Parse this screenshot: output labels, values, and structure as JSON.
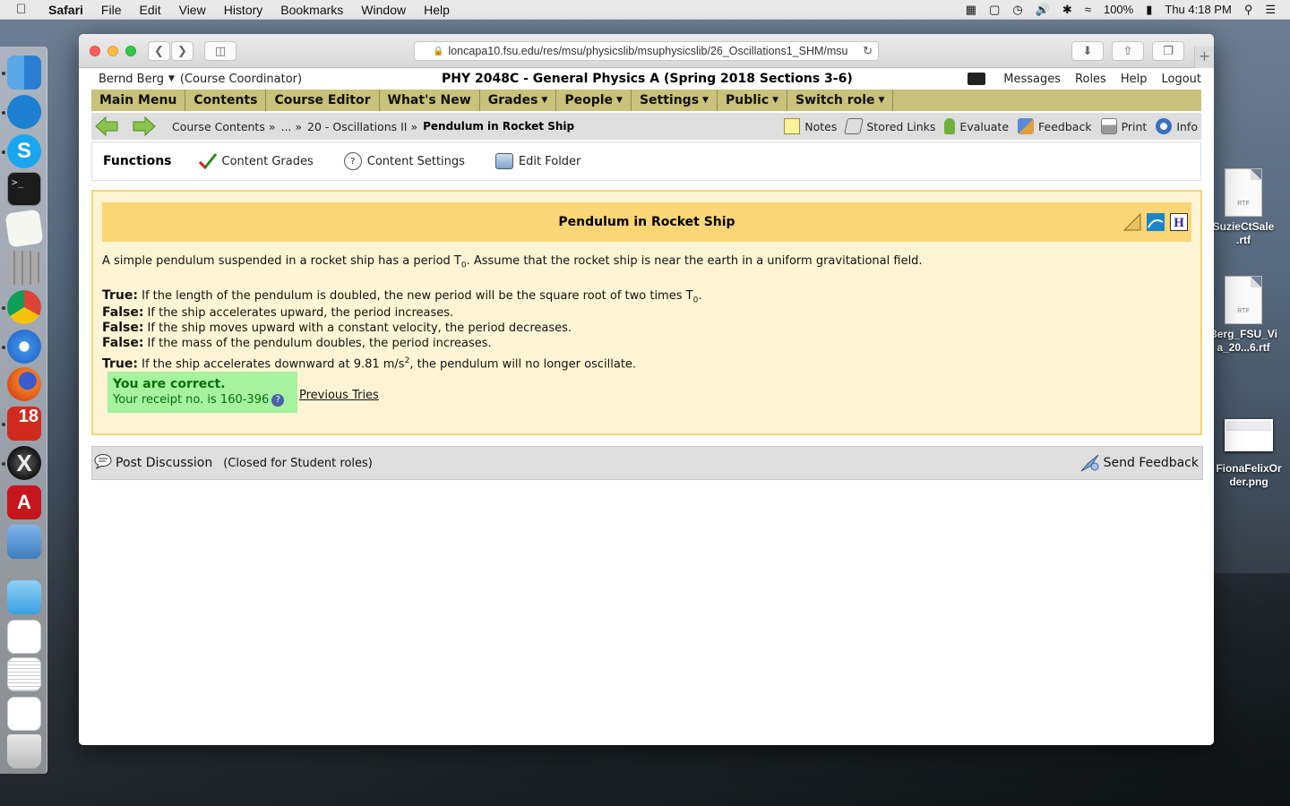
{
  "menubar": {
    "app": "Safari",
    "items": [
      "File",
      "Edit",
      "View",
      "History",
      "Bookmarks",
      "Window",
      "Help"
    ],
    "battery": "100%",
    "clock": "Thu 4:18 PM"
  },
  "desktop_files": [
    {
      "name": "SuzieCtSale\n.rtf",
      "badge": "RTF"
    },
    {
      "name": "Berg_FSU_Vi\na_20...6.rtf",
      "badge": "RTF"
    },
    {
      "name": "FionaFelixOr\nder.png"
    }
  ],
  "browser": {
    "url": "loncapa10.fsu.edu/res/msu/physicslib/msuphysicslib/26_Oscillations1_SHM/msu"
  },
  "userbar": {
    "user": "Bernd Berg",
    "role": "(Course Coordinator)",
    "course": "PHY 2048C - General Physics A (Spring 2018 Sections 3-6)",
    "links": [
      "Messages",
      "Roles",
      "Help",
      "Logout"
    ]
  },
  "mainmenu": [
    {
      "label": "Main Menu",
      "dropdown": false
    },
    {
      "label": "Contents",
      "dropdown": false
    },
    {
      "label": "Course Editor",
      "dropdown": false
    },
    {
      "label": "What's New",
      "dropdown": false
    },
    {
      "label": "Grades",
      "dropdown": true
    },
    {
      "label": "People",
      "dropdown": true
    },
    {
      "label": "Settings",
      "dropdown": true
    },
    {
      "label": "Public",
      "dropdown": true
    },
    {
      "label": "Switch role",
      "dropdown": true
    }
  ],
  "breadcrumbs": {
    "items": [
      "Course Contents »",
      "... »",
      "20 - Oscillations II »"
    ],
    "current": "Pendulum in Rocket Ship"
  },
  "navtools": [
    "Notes",
    "Stored Links",
    "Evaluate",
    "Feedback",
    "Print",
    "Info"
  ],
  "functions": {
    "title": "Functions",
    "items": [
      "Content Grades",
      "Content Settings",
      "Edit Folder"
    ]
  },
  "problem": {
    "title": "Pendulum in Rocket Ship",
    "intro_a": "A simple pendulum suspended in a rocket ship has a period T",
    "intro_sub": "0",
    "intro_b": ". Assume that the rocket ship is near the earth in a uniform gravitational field.",
    "statements": [
      {
        "verdict": "True:",
        "text": " If the length of the pendulum is doubled, the new period will be the square root of two times T",
        "sub": "0",
        "after": "."
      },
      {
        "verdict": "False:",
        "text": " If the ship accelerates upward, the period increases."
      },
      {
        "verdict": "False:",
        "text": " If the ship moves upward with a constant velocity, the period decreases."
      },
      {
        "verdict": "False:",
        "text": " If the mass of the pendulum doubles, the period increases."
      },
      {
        "verdict": "True:",
        "text": " If the ship accelerates downward at 9.81 m/s",
        "sup": "2",
        "after": ", the pendulum will no longer oscillate."
      }
    ],
    "result_title": "You are correct.",
    "receipt": "Your receipt no. is 160-396",
    "previous_tries": "Previous Tries"
  },
  "discussion": {
    "post": "Post Discussion",
    "closed": "(Closed for Student roles)",
    "send_feedback": "Send Feedback"
  }
}
